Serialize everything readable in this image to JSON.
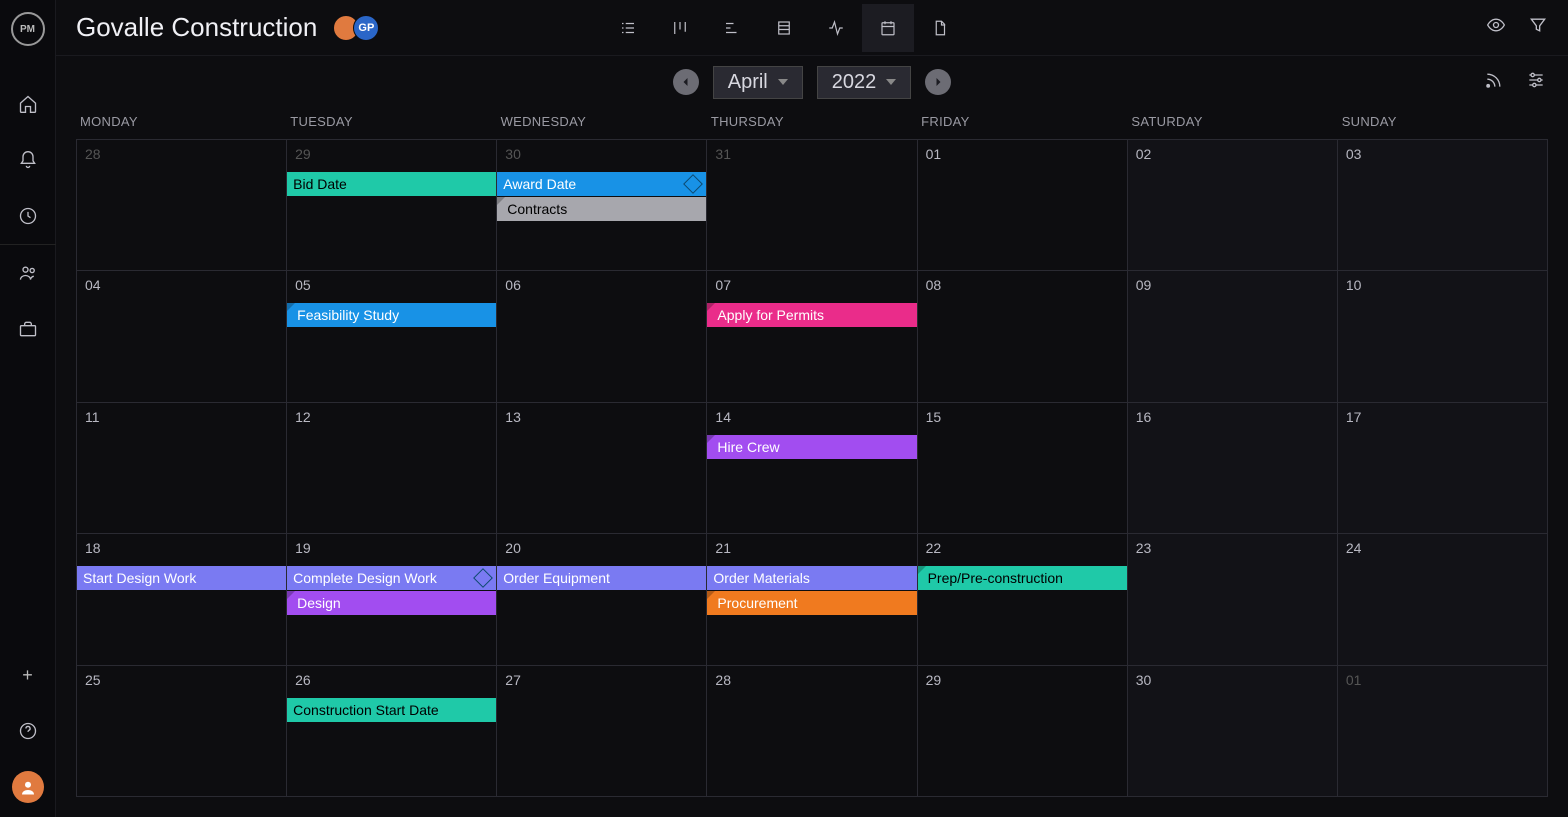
{
  "header": {
    "logo": "PM",
    "project_title": "Govalle Construction",
    "avatars": [
      {
        "label": "",
        "color": "#e07a3f"
      },
      {
        "label": "GP",
        "color": "#2a66c8"
      }
    ]
  },
  "dateNav": {
    "month": "April",
    "year": "2022"
  },
  "days_of_week": [
    "MONDAY",
    "TUESDAY",
    "WEDNESDAY",
    "THURSDAY",
    "FRIDAY",
    "SATURDAY",
    "SUNDAY"
  ],
  "weeks": [
    [
      {
        "num": "28",
        "other": true
      },
      {
        "num": "29",
        "other": true
      },
      {
        "num": "30",
        "other": true
      },
      {
        "num": "31",
        "other": true
      },
      {
        "num": "01"
      },
      {
        "num": "02",
        "off": true
      },
      {
        "num": "03",
        "off": true
      }
    ],
    [
      {
        "num": "04"
      },
      {
        "num": "05"
      },
      {
        "num": "06"
      },
      {
        "num": "07"
      },
      {
        "num": "08"
      },
      {
        "num": "09",
        "off": true
      },
      {
        "num": "10",
        "off": true
      }
    ],
    [
      {
        "num": "11"
      },
      {
        "num": "12"
      },
      {
        "num": "13"
      },
      {
        "num": "14"
      },
      {
        "num": "15"
      },
      {
        "num": "16",
        "off": true
      },
      {
        "num": "17",
        "off": true
      }
    ],
    [
      {
        "num": "18"
      },
      {
        "num": "19"
      },
      {
        "num": "20"
      },
      {
        "num": "21"
      },
      {
        "num": "22"
      },
      {
        "num": "23",
        "off": true
      },
      {
        "num": "24",
        "off": true
      }
    ],
    [
      {
        "num": "25"
      },
      {
        "num": "26"
      },
      {
        "num": "27"
      },
      {
        "num": "28"
      },
      {
        "num": "29"
      },
      {
        "num": "30",
        "off": true
      },
      {
        "num": "01",
        "other": true,
        "off": true
      }
    ]
  ],
  "events": [
    {
      "row": 0,
      "startCol": 1,
      "span": 1,
      "lane": 0,
      "label": "Bid Date",
      "bg": "#1fc9a8",
      "txt": "black"
    },
    {
      "row": 0,
      "startCol": 2,
      "span": 1,
      "lane": 0,
      "label": "Award Date",
      "bg": "#1892e6",
      "txt": "white",
      "milestone": true
    },
    {
      "row": 0,
      "startCol": 2,
      "span": 1,
      "lane": 1,
      "label": "Contracts",
      "bg": "#a7a7ad",
      "txt": "black",
      "tri": true
    },
    {
      "row": 1,
      "startCol": 1,
      "span": 1,
      "lane": 0,
      "label": "Feasibility Study",
      "bg": "#1892e6",
      "txt": "white",
      "tri": true
    },
    {
      "row": 1,
      "startCol": 3,
      "span": 1,
      "lane": 0,
      "label": "Apply for Permits",
      "bg": "#ea2c8a",
      "txt": "white",
      "tri": true
    },
    {
      "row": 2,
      "startCol": 3,
      "span": 1,
      "lane": 0,
      "label": "Hire Crew",
      "bg": "#a24df0",
      "txt": "white",
      "tri": true
    },
    {
      "row": 3,
      "startCol": 0,
      "span": 1,
      "lane": 0,
      "label": "Start Design Work",
      "bg": "#7a7af2",
      "txt": "white"
    },
    {
      "row": 3,
      "startCol": 1,
      "span": 1,
      "lane": 0,
      "label": "Complete Design Work",
      "bg": "#7a7af2",
      "txt": "white",
      "milestone": true
    },
    {
      "row": 3,
      "startCol": 2,
      "span": 1,
      "lane": 0,
      "label": "Order Equipment",
      "bg": "#7a7af2",
      "txt": "white"
    },
    {
      "row": 3,
      "startCol": 3,
      "span": 1,
      "lane": 0,
      "label": "Order Materials",
      "bg": "#7a7af2",
      "txt": "white"
    },
    {
      "row": 3,
      "startCol": 4,
      "span": 1,
      "lane": 0,
      "label": "Prep/Pre-construction",
      "bg": "#1fc9a8",
      "txt": "black",
      "tri": true
    },
    {
      "row": 3,
      "startCol": 1,
      "span": 1,
      "lane": 1,
      "label": "Design",
      "bg": "#a24df0",
      "txt": "white",
      "tri": true
    },
    {
      "row": 3,
      "startCol": 3,
      "span": 1,
      "lane": 1,
      "label": "Procurement",
      "bg": "#f07a1f",
      "txt": "white",
      "tri": true
    },
    {
      "row": 4,
      "startCol": 1,
      "span": 1,
      "lane": 0,
      "label": "Construction Start Date",
      "bg": "#1fc9a8",
      "txt": "black"
    }
  ],
  "colors": {
    "teal": "#1fc9a8",
    "blue": "#1892e6",
    "gray": "#a7a7ad",
    "pink": "#ea2c8a",
    "purple": "#a24df0",
    "indigo": "#7a7af2",
    "orange": "#f07a1f"
  }
}
